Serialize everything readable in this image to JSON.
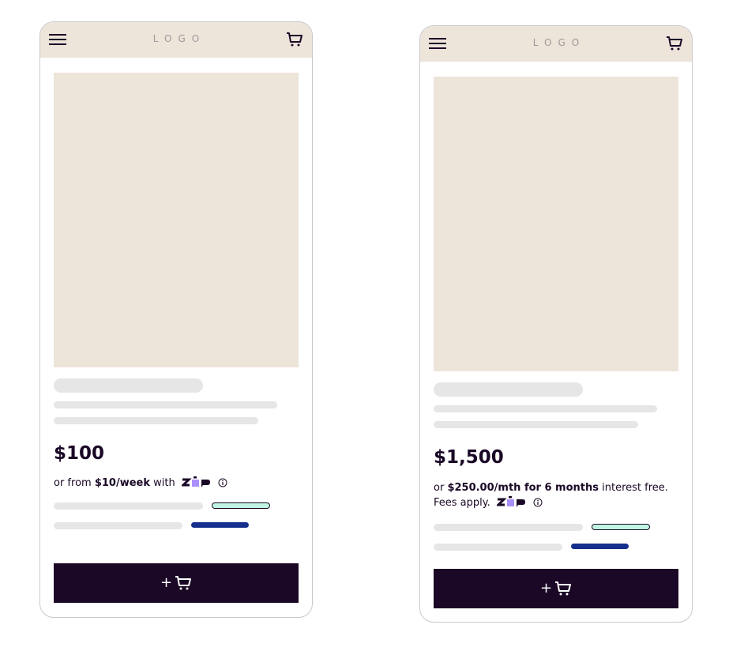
{
  "screens": [
    {
      "header": {
        "logo": "LOGO",
        "menu_icon": "hamburger-menu-icon",
        "cart_icon": "cart-icon"
      },
      "product": {
        "price": "$100",
        "finance_prefix": "or from ",
        "finance_amount": "$10/week",
        "finance_suffix": " with"
      },
      "add_button": {
        "label": "+"
      }
    },
    {
      "header": {
        "logo": "LOGO",
        "menu_icon": "hamburger-menu-icon",
        "cart_icon": "cart-icon"
      },
      "product": {
        "price": "$1,500",
        "finance_prefix": "or ",
        "finance_amount": "$250.00/mth for 6 months",
        "finance_suffix": " interest free. Fees apply."
      },
      "add_button": {
        "label": "+"
      }
    }
  ],
  "colors": {
    "header_bg": "#ede4da",
    "hero_bg": "#ede4da",
    "skeleton": "#e6e6e6",
    "primary_dark": "#1a0826",
    "zip_purple": "#aa8fff",
    "mint_pill": "#bff5e2",
    "blue_pill": "#142f8c"
  }
}
